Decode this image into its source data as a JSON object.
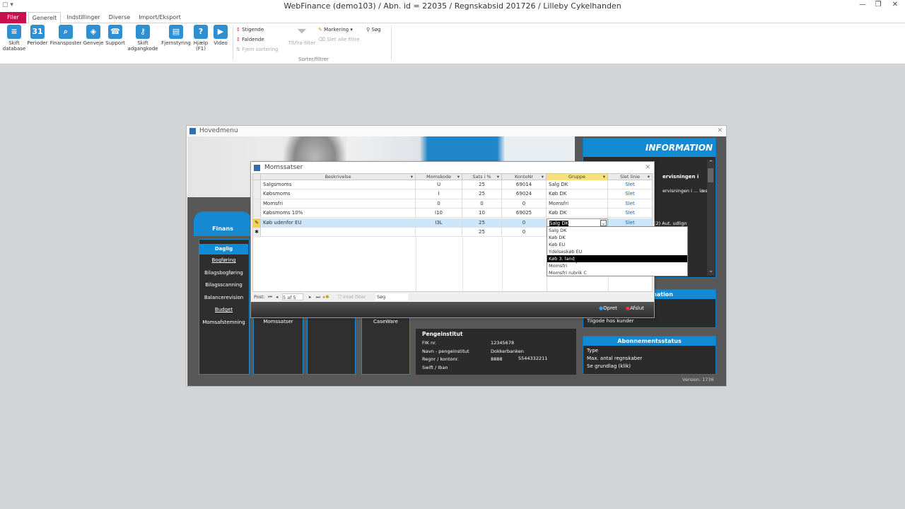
{
  "window": {
    "title": "WebFinance (demo103) / Abn. id = 22035 / Regnskabsid 201726 / Lilleby Cykelhanden"
  },
  "ribbon_tabs": [
    "Filer",
    "Generelt",
    "Indstillinger",
    "Diverse",
    "Import/Eksport"
  ],
  "ribbon_buttons": [
    {
      "label": "Skift database",
      "icon": "database-icon"
    },
    {
      "label": "Perioder",
      "icon": "calendar-icon"
    },
    {
      "label": "Finansposter",
      "icon": "search-icon"
    },
    {
      "label": "Genveje",
      "icon": "cube-icon"
    },
    {
      "label": "Support",
      "icon": "phone-icon"
    },
    {
      "label": "Skift adgangkode",
      "icon": "key-icon"
    },
    {
      "label": "Fjernstyring",
      "icon": "remote-icon"
    },
    {
      "label": "Hjælp (F1)",
      "icon": "help-icon"
    },
    {
      "label": "Video",
      "icon": "video-icon"
    }
  ],
  "sort_group": {
    "stigende": "Stigende",
    "faldende": "Faldende",
    "fjern_sortering": "Fjern sortering",
    "tilfra_filter": "Til/fra-filter",
    "markering": "Markering",
    "slet_alle_filtre": "Slet alle filtre",
    "soeg": "Søg",
    "group_label": "Sorter/filtrer"
  },
  "hovedmenu": {
    "title": "Hovedmenu",
    "finans_tab": "Finans",
    "nav": [
      "Daglig",
      "Bogføring",
      "Bilagsbogføring",
      "Bilagsscanning",
      "Balancerevision",
      "Budget",
      "Momsafstemning"
    ],
    "tiles": [
      "Momssatser",
      "CaseWare"
    ],
    "information_title": "INFORMATION",
    "info_lines": [
      "ervisningen i",
      "ervisningen i ... læs",
      "(2) Aut. udlign",
      "an"
    ],
    "info_section_title": "rmation",
    "info_section_line": "Tilgode hos kunder",
    "abonnement_title": "Abonnementsstatus",
    "abonnement_lines": [
      "Type",
      "Max. antal regnskaber",
      "Se grundlag (klik)"
    ],
    "pengeinstitut_title": "Pengeinstitut",
    "pengeinstitut": [
      {
        "label": "FIK nr.",
        "value": "12345678",
        "value2": ""
      },
      {
        "label": "Navn - pengeinstitut",
        "value": "Dokkerbanken",
        "value2": ""
      },
      {
        "label": "Regnr / kontonr.",
        "value": "8888",
        "value2": "5544332211"
      },
      {
        "label": "Swift / Iban",
        "value": "",
        "value2": ""
      }
    ],
    "version": "Version: 1736"
  },
  "momssatser": {
    "title": "Momssatser",
    "columns": [
      "Beskrivelse",
      "Momskode",
      "Sats i %",
      "KontoNr",
      "Gruppe",
      "Slet linie"
    ],
    "rows": [
      {
        "beskrivelse": "Salgsmoms",
        "momskode": "U",
        "sats": "25",
        "konto": "69014",
        "gruppe": "Salg DK",
        "slet": "Slet"
      },
      {
        "beskrivelse": "Købsmoms",
        "momskode": "I",
        "sats": "25",
        "konto": "69024",
        "gruppe": "Køb DK",
        "slet": "Slet"
      },
      {
        "beskrivelse": "Momsfri",
        "momskode": "0",
        "sats": "0",
        "konto": "0",
        "gruppe": "Momsfri",
        "slet": "Slet"
      },
      {
        "beskrivelse": "Købsmoms 10%",
        "momskode": "I10",
        "sats": "10",
        "konto": "69025",
        "gruppe": "Køb DK",
        "slet": "Slet"
      },
      {
        "beskrivelse": "Køb udenfor EU",
        "momskode": "I3L",
        "sats": "25",
        "konto": "0",
        "gruppe": "Salg DK",
        "slet": "Slet"
      }
    ],
    "new_row": {
      "sats": "25",
      "konto": "0"
    },
    "dropdown_options": [
      "Salg DK",
      "Køb DK",
      "Køb EU",
      "Ydelseskøb EU",
      "Køb 3. land",
      "Momsfri",
      "Momsfri rubrik C"
    ],
    "dropdown_highlight": 4,
    "nav": {
      "post_label": "Post:",
      "position": "5 af 5",
      "filter": "Intet filter",
      "search": "Søg"
    },
    "buttons": {
      "opret": "Opret",
      "afslut": "Afslut"
    }
  }
}
